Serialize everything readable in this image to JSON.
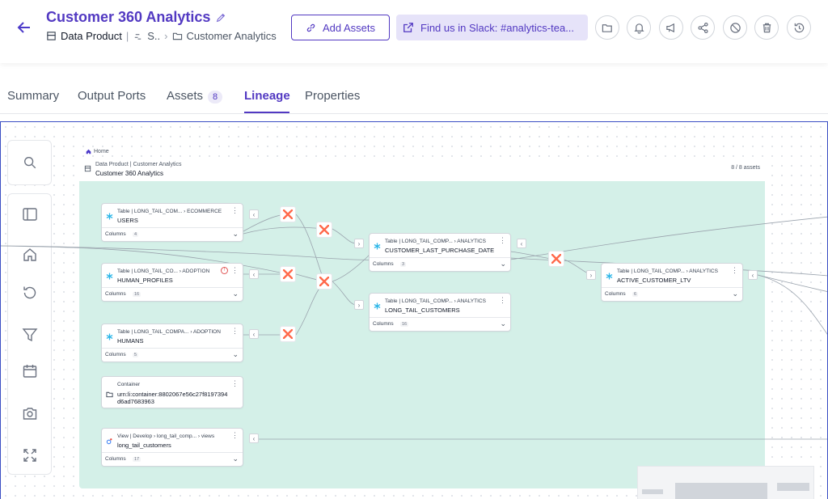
{
  "header": {
    "title": "Customer 360 Analytics",
    "breadcrumb": {
      "type": "Data Product",
      "domain_truncated": "S..",
      "folder": "Customer Analytics"
    },
    "add_assets_label": "Add Assets",
    "slack_label": "Find us in Slack: #analytics-tea..."
  },
  "tabs": {
    "summary": "Summary",
    "output_ports": "Output Ports",
    "assets": "Assets",
    "assets_count": "8",
    "lineage": "Lineage",
    "properties": "Properties"
  },
  "lineage": {
    "home_crumb": "Home",
    "group": {
      "type": "Data Product",
      "folder": "Customer Analytics",
      "name": "Customer 360 Analytics",
      "count": "8 / 8 assets"
    },
    "columns_label": "Columns",
    "nodes": {
      "users": {
        "type": "Table",
        "path": "LONG_TAIL_COM...",
        "schema": "ECOMMERCE",
        "name": "USERS",
        "cols": "4"
      },
      "human_profiles": {
        "type": "Table",
        "path": "LONG_TAIL_CO...",
        "schema": "ADOPTION",
        "name": "HUMAN_PROFILES",
        "cols": "16"
      },
      "humans": {
        "type": "Table",
        "path": "LONG_TAIL_COMPA...",
        "schema": "ADOPTION",
        "name": "HUMANS",
        "cols": "5"
      },
      "container": {
        "type": "Container",
        "name_line1": "urn:li:container:8802067e56c27f8197394",
        "name_line2": "d6ad7683963"
      },
      "view": {
        "type": "View",
        "path": "Develop",
        "schema": "long_tail_comp...",
        "extra": "views",
        "name": "long_tail_customers",
        "cols": "17"
      },
      "clpd": {
        "type": "Table",
        "path": "LONG_TAIL_COMP...",
        "schema": "ANALYTICS",
        "name": "CUSTOMER_LAST_PURCHASE_DATE",
        "cols": "3"
      },
      "ltc": {
        "type": "Table",
        "path": "LONG_TAIL_COMP...",
        "schema": "ANALYTICS",
        "name": "LONG_TAIL_CUSTOMERS",
        "cols": "16"
      },
      "acl": {
        "type": "Table",
        "path": "LONG_TAIL_COMP...",
        "schema": "ANALYTICS",
        "name": "ACTIVE_CUSTOMER_LTV",
        "cols": "6"
      }
    }
  },
  "colors": {
    "accent": "#5239c2",
    "group_background": "#d4f0e8",
    "snowflake": "#29b5e8",
    "dbt": "#ff694b"
  }
}
